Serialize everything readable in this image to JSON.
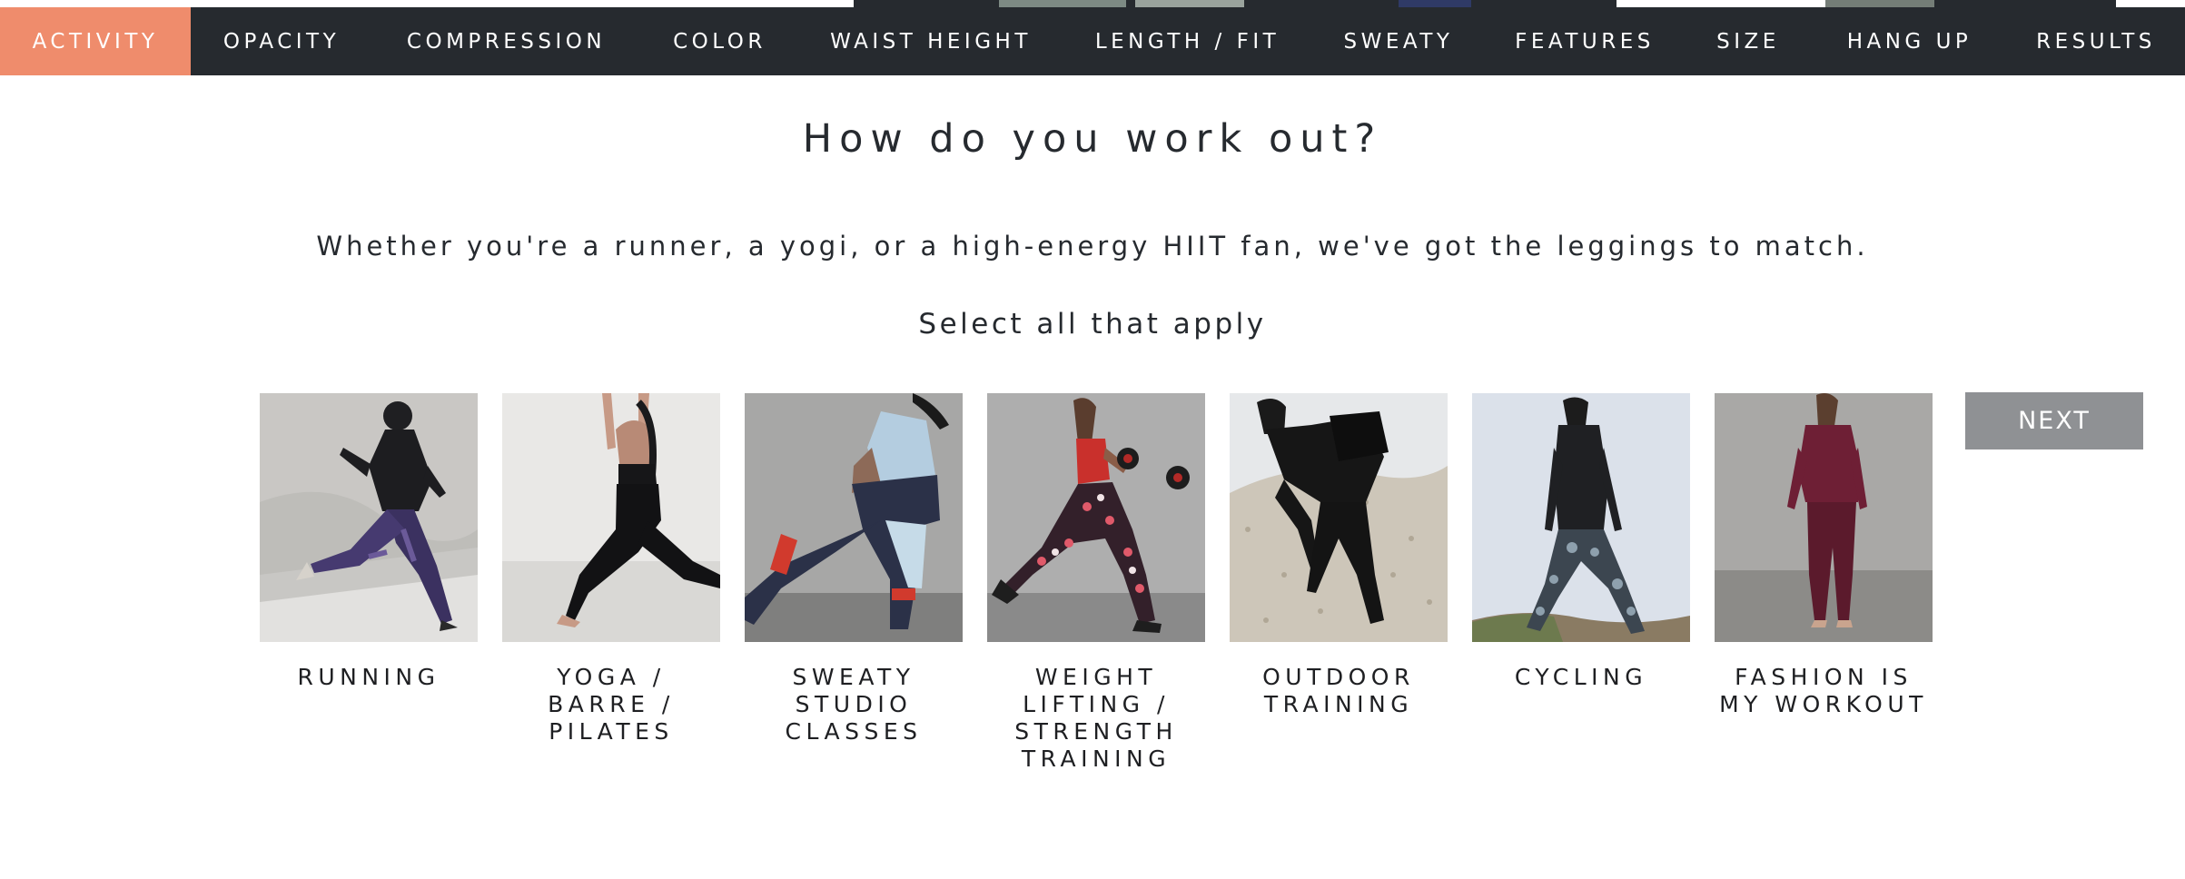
{
  "nav": {
    "items": [
      {
        "label": "ACTIVITY",
        "active": true
      },
      {
        "label": "OPACITY",
        "active": false
      },
      {
        "label": "COMPRESSION",
        "active": false
      },
      {
        "label": "COLOR",
        "active": false
      },
      {
        "label": "WAIST HEIGHT",
        "active": false
      },
      {
        "label": "LENGTH / FIT",
        "active": false
      },
      {
        "label": "SWEATY",
        "active": false
      },
      {
        "label": "FEATURES",
        "active": false
      },
      {
        "label": "SIZE",
        "active": false
      },
      {
        "label": "HANG UP",
        "active": false
      },
      {
        "label": "RESULTS",
        "active": false
      }
    ],
    "colors": {
      "bar": "#262a2f",
      "active": "#ef8c6c",
      "text": "#ffffff"
    }
  },
  "main": {
    "heading": "How do you work out?",
    "subheading": "Whether you're a runner, a yogi, or a high-energy HIIT fan, we've got the leggings to match.",
    "instruction": "Select all that apply"
  },
  "options": [
    {
      "label": "RUNNING",
      "image": "runner-photo"
    },
    {
      "label": "YOGA / BARRE / PILATES",
      "image": "yoga-photo"
    },
    {
      "label": "SWEATY STUDIO CLASSES",
      "image": "studio-photo"
    },
    {
      "label": "WEIGHT LIFTING / STRENGTH TRAINING",
      "image": "weights-photo"
    },
    {
      "label": "OUTDOOR TRAINING",
      "image": "outdoor-photo"
    },
    {
      "label": "CYCLING",
      "image": "cycling-photo"
    },
    {
      "label": "FASHION IS MY WORKOUT",
      "image": "fashion-photo"
    }
  ],
  "actions": {
    "next_label": "NEXT",
    "next_color": "#8f9194"
  }
}
